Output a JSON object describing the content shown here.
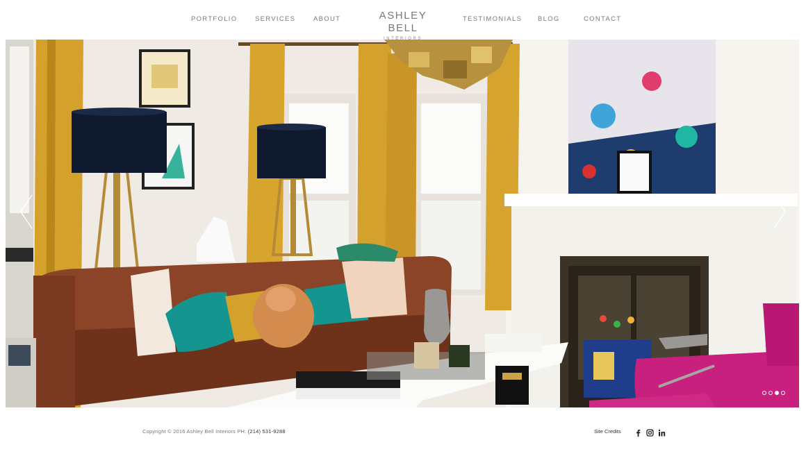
{
  "nav": {
    "portfolio": "PORTFOLIO",
    "services": "SERVICES",
    "about": "ABOUT",
    "testimonials": "TESTIMONIALS",
    "blog": "BLOG",
    "contact": "CONTACT"
  },
  "logo": {
    "name": "ASHLEY BELL",
    "sub": "INTERIORS"
  },
  "slideshow": {
    "prev_icon": "chevron-left-icon",
    "next_icon": "chevron-right-icon",
    "slide_count": 4,
    "active_slide": 3
  },
  "footer": {
    "copyright": "Copyright © 2016 Ashley Bell Interiors PH: ",
    "phone": "(214) 531-9288",
    "site_credits": "Site Credits",
    "social": [
      "facebook-icon",
      "instagram-icon",
      "linkedin-icon"
    ]
  },
  "colors": {
    "curtain": "#d4a12c",
    "sofa": "#7a3a22",
    "teal_pillow": "#14958f",
    "magenta_chair": "#c8207e",
    "wall": "#f3efea"
  }
}
